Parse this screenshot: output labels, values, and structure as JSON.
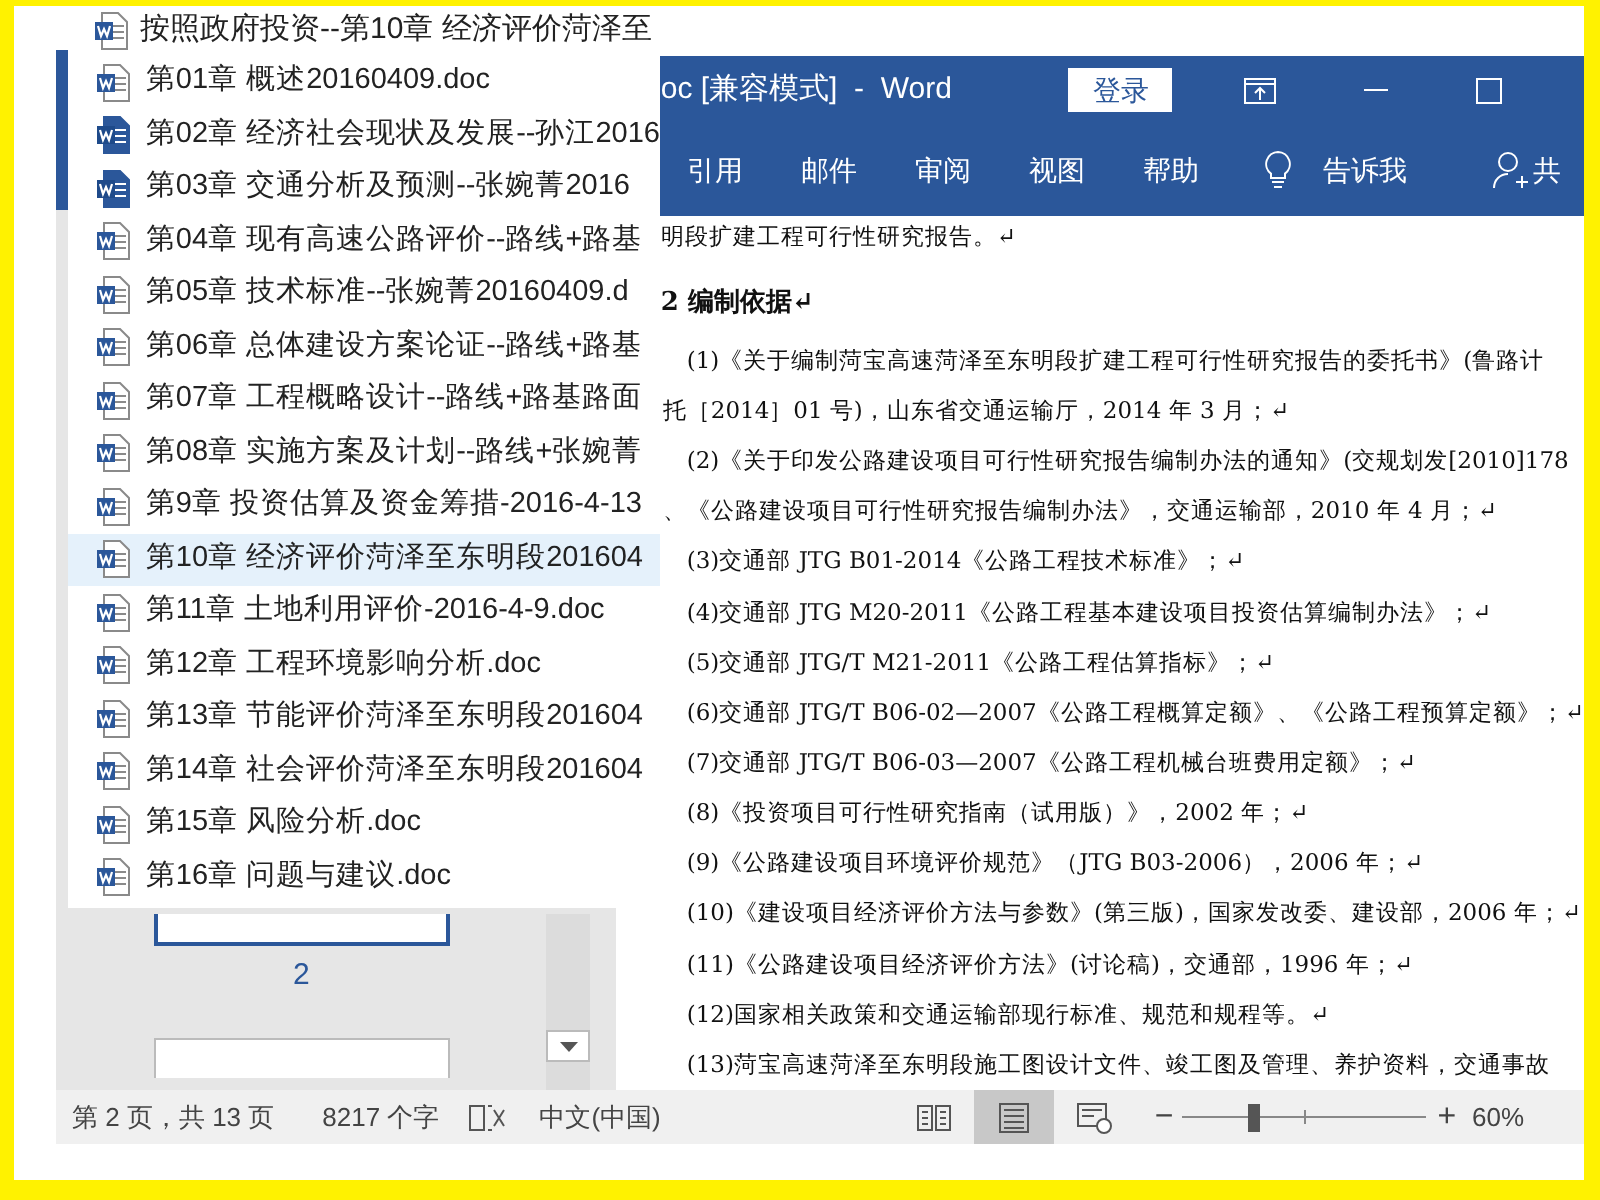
{
  "jump_list": {
    "header": "按照政府投资--第10章 经济评价菏泽至",
    "items": [
      {
        "label": "第01章 概述20160409.doc",
        "kind": "outline",
        "selected": false
      },
      {
        "label": "第02章 经济社会现状及发展--孙江2016",
        "kind": "filled",
        "selected": false
      },
      {
        "label": "第03章 交通分析及预测--张婉菁2016",
        "kind": "filled",
        "selected": false
      },
      {
        "label": "第04章 现有高速公路评价--路线+路基",
        "kind": "outline",
        "selected": false
      },
      {
        "label": "第05章 技术标准--张婉菁20160409.d",
        "kind": "outline",
        "selected": false
      },
      {
        "label": "第06章 总体建设方案论证--路线+路基",
        "kind": "outline",
        "selected": false
      },
      {
        "label": "第07章 工程概略设计--路线+路基路面",
        "kind": "outline",
        "selected": false
      },
      {
        "label": "第08章 实施方案及计划--路线+张婉菁",
        "kind": "outline",
        "selected": false
      },
      {
        "label": "第9章 投资估算及资金筹措-2016-4-13",
        "kind": "outline",
        "selected": false
      },
      {
        "label": "第10章 经济评价菏泽至东明段201604",
        "kind": "outline",
        "selected": true
      },
      {
        "label": "第11章 土地利用评价-2016-4-9.doc",
        "kind": "outline",
        "selected": false
      },
      {
        "label": "第12章 工程环境影响分析.doc",
        "kind": "outline",
        "selected": false
      },
      {
        "label": "第13章 节能评价菏泽至东明段201604",
        "kind": "outline",
        "selected": false
      },
      {
        "label": "第14章 社会评价菏泽至东明段201604",
        "kind": "outline",
        "selected": false
      },
      {
        "label": "第15章 风险分析.doc",
        "kind": "outline",
        "selected": false
      },
      {
        "label": "第16章 问题与建议.doc",
        "kind": "outline",
        "selected": false
      }
    ]
  },
  "window": {
    "title": "oc [兼容模式]  -  Word",
    "sign_in": "登录"
  },
  "ribbon_tabs": [
    "引用",
    "邮件",
    "审阅",
    "视图",
    "帮助"
  ],
  "tell_me": "告诉我",
  "share": "共",
  "navigation": {
    "page_label": "2"
  },
  "document": {
    "lines": [
      {
        "kind": "plain",
        "text": "明段扩建工程可行性研究报告。↵"
      },
      {
        "kind": "heading",
        "text": "2  编制依据↵"
      },
      {
        "kind": "indent",
        "text": "(1)《关于编制菏宝高速菏泽至东明段扩建工程可行性研究报告的委托书》(鲁路计"
      },
      {
        "kind": "cont",
        "text": "托［2014］01 号)，山东省交通运输厅，2014 年 3 月；↵"
      },
      {
        "kind": "indent",
        "text": "(2)《关于印发公路建设项目可行性研究报告编制办法的通知》(交规划发[2010]178"
      },
      {
        "kind": "cont",
        "text": "、《公路建设项目可行性研究报告编制办法》，交通运输部，2010 年 4 月；↵"
      },
      {
        "kind": "indent",
        "text": "(3)交通部 JTG B01-2014《公路工程技术标准》；↵"
      },
      {
        "kind": "indent",
        "text": "(4)交通部 JTG M20-2011《公路工程基本建设项目投资估算编制办法》；↵"
      },
      {
        "kind": "indent",
        "text": "(5)交通部 JTG/T M21-2011《公路工程估算指标》；↵"
      },
      {
        "kind": "indent",
        "text": "(6)交通部 JTG/T B06-02—2007《公路工程概算定额》、《公路工程预算定额》；↵"
      },
      {
        "kind": "indent",
        "text": "(7)交通部 JTG/T B06-03—2007《公路工程机械台班费用定额》；↵"
      },
      {
        "kind": "indent",
        "text": "(8)《投资项目可行性研究指南（试用版）》，2002 年；↵"
      },
      {
        "kind": "indent",
        "text": "(9)《公路建设项目环境评价规范》（JTG B03-2006），2006 年；↵"
      },
      {
        "kind": "indent",
        "text": "(10)《建设项目经济评价方法与参数》(第三版)，国家发改委、建设部，2006 年；↵"
      },
      {
        "kind": "indent",
        "text": "(11)《公路建设项目经济评价方法》(讨论稿)，交通部，1996 年；↵"
      },
      {
        "kind": "indent",
        "text": "(12)国家相关政策和交通运输部现行标准、规范和规程等。↵"
      },
      {
        "kind": "indent",
        "text": "(13)菏宝高速菏泽至东明段施工图设计文件、竣工图及管理、养护资料，交通事故"
      }
    ]
  },
  "status_bar": {
    "page": "第 2 页，共 13 页",
    "words": "8217 个字",
    "language": "中文(中国)",
    "views": [
      {
        "kind": "read",
        "selected": false
      },
      {
        "kind": "print",
        "selected": true
      },
      {
        "kind": "web",
        "selected": false
      }
    ],
    "zoom": {
      "out": "−",
      "in": "+",
      "level": 0.3,
      "reading": "60%"
    }
  }
}
